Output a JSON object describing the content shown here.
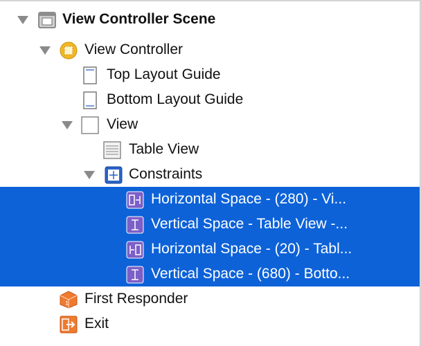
{
  "outline": {
    "scene": {
      "label": "View Controller Scene",
      "icon": "scene-icon"
    },
    "view_controller": {
      "label": "View Controller",
      "icon": "view-controller-icon"
    },
    "top_layout_guide": {
      "label": "Top Layout Guide",
      "icon": "top-layout-guide-icon"
    },
    "bottom_layout_guide": {
      "label": "Bottom Layout Guide",
      "icon": "bottom-layout-guide-icon"
    },
    "view": {
      "label": "View",
      "icon": "view-icon"
    },
    "table_view": {
      "label": "Table View",
      "icon": "table-view-icon"
    },
    "constraints": {
      "label": "Constraints",
      "icon": "constraints-icon"
    },
    "constraint_items": [
      {
        "label": "Horizontal Space - (280) - Vi...",
        "icon": "horizontal-space-trailing-icon"
      },
      {
        "label": "Vertical Space - Table View -...",
        "icon": "vertical-space-icon"
      },
      {
        "label": "Horizontal Space - (20) - Tabl...",
        "icon": "horizontal-space-leading-icon"
      },
      {
        "label": "Vertical Space - (680) - Botto...",
        "icon": "vertical-space-icon"
      }
    ],
    "first_responder": {
      "label": "First Responder",
      "icon": "first-responder-icon"
    },
    "exit": {
      "label": "Exit",
      "icon": "exit-icon"
    }
  },
  "colors": {
    "selection": "#0d62d8",
    "disclosure": "#8a8a8a",
    "view_controller_icon": "#f2b824",
    "constraint_icon": "#7c5fc7",
    "first_responder_icon": "#f07a2e",
    "exit_icon": "#f07a2e"
  }
}
